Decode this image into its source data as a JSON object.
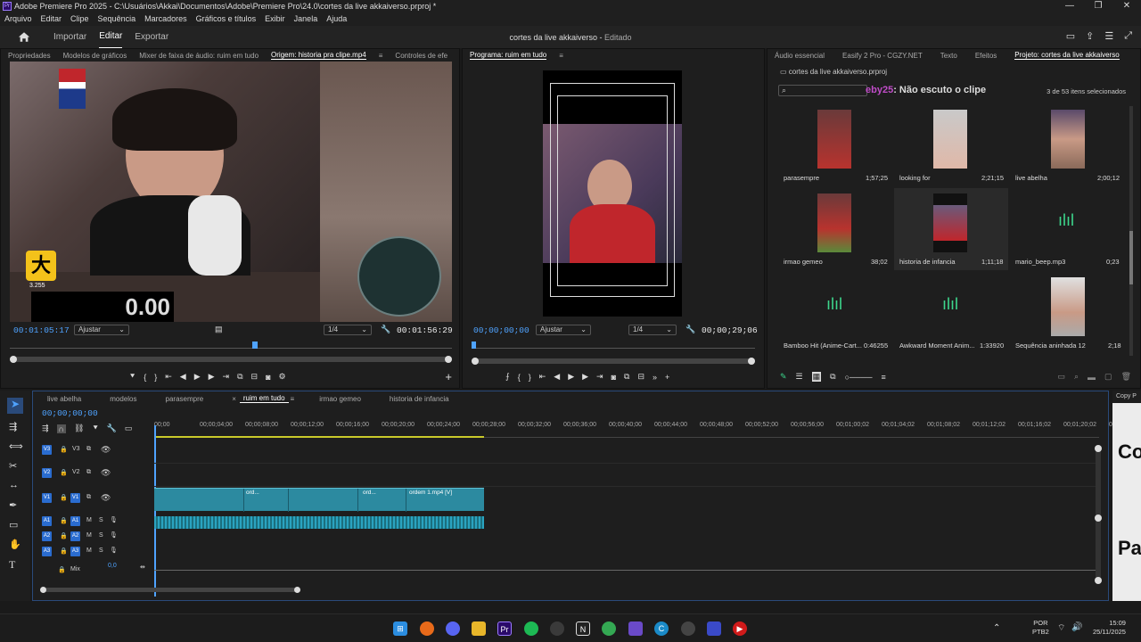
{
  "titlebar": {
    "title": "Adobe Premiere Pro 2025 - C:\\Usuários\\Akkai\\Documentos\\Adobe\\Premiere Pro\\24.0\\cortes da live akkaiverso.prproj *",
    "logo": "Pr",
    "min": "—",
    "max": "❐",
    "close": "✕"
  },
  "menu": [
    "Arquivo",
    "Editar",
    "Clipe",
    "Sequência",
    "Marcadores",
    "Gráficos e títulos",
    "Exibir",
    "Janela",
    "Ajuda"
  ],
  "header": {
    "home_icon": "home-icon",
    "tabs": [
      "Importar",
      "Editar",
      "Exportar"
    ],
    "active_tab": "Editar",
    "project_title": "cortes da live akkaiverso",
    "project_status": "Editado"
  },
  "source_panel": {
    "tabs": [
      "Propriedades",
      "Modelos de gráficos",
      "Mixer de faixa de áudio: ruim em tudo",
      "Origem: historia pra clipe.mp4",
      "Controles de efe"
    ],
    "active_tab": "Origem: historia pra clipe.mp4",
    "overlay_counter": "3.255",
    "overlay_timer": "0.00",
    "timecode_in": "00:01:05:17",
    "fit": "Ajustar",
    "resolution": "1/4",
    "timecode_out": "00:01:56:29"
  },
  "program_panel": {
    "title": "Programa: ruim em tudo",
    "timecode_in": "00;00;00;00",
    "fit": "Ajustar",
    "resolution": "1/4",
    "timecode_out": "00;00;29;06"
  },
  "project_panel": {
    "tabs": [
      "Áudio essencial",
      "Easify 2 Pro - CGZY.NET",
      "Texto",
      "Efeitos",
      "Projeto: cortes da live akkaiverso"
    ],
    "active_tab": "Projeto: cortes da live akkaiverso",
    "project_file": "cortes da live akkaiverso.prproj",
    "search_placeholder": "",
    "chat_user": "eby25",
    "chat_message": ": Não escuto o clipe",
    "selection_info": "3 de 53 itens selecionados",
    "items": [
      {
        "name": "parasempre",
        "duration": "1;57;25"
      },
      {
        "name": "looking for",
        "duration": "2;21;15"
      },
      {
        "name": "live abelha",
        "duration": "2;00;12"
      },
      {
        "name": "irmao gemeo",
        "duration": "38;02"
      },
      {
        "name": "historia de infancia",
        "duration": "1;11;18"
      },
      {
        "name": "mario_beep.mp3",
        "duration": "0;23"
      },
      {
        "name": "Bamboo Hit (Anime-Cart...",
        "duration": "0:46255"
      },
      {
        "name": "Awkward Moment Anim...",
        "duration": "1:33920"
      },
      {
        "name": "Sequência aninhada 12",
        "duration": "2;18"
      }
    ]
  },
  "timeline": {
    "tabs": [
      "live abelha",
      "modelos",
      "parasempre",
      "ruim em tudo",
      "irmao gemeo",
      "historia de infancia"
    ],
    "active_tab": "ruim em tudo",
    "close_mark": "×",
    "timecode": "00;00;00;00",
    "ruler": [
      "00;00",
      "00;00;04;00",
      "00;00;08;00",
      "00;00;12;00",
      "00;00;16;00",
      "00;00;20;00",
      "00;00;24;00",
      "00;00;28;00",
      "00;00;32;00",
      "00;00;36;00",
      "00;00;40;00",
      "00;00;44;00",
      "00;00;48;00",
      "00;00;52;00",
      "00;00;56;00",
      "00;01;00;02",
      "00;01;04;02",
      "00;01;08;02",
      "00;01;12;02",
      "00;01;16;02",
      "00;01;20;02",
      "00;"
    ],
    "tracks_video": [
      "V3",
      "V2",
      "V1"
    ],
    "tracks_audio": [
      "A1",
      "A2",
      "A3"
    ],
    "mix_label": "Mix",
    "mix_value": "0,0",
    "clip_labels": [
      "ord...",
      "ord...",
      "ordem 1.mp4 [V]"
    ],
    "audio_m": "M",
    "audio_s": "S"
  },
  "right_edge": {
    "label_top": "Copy P",
    "big1": "Co",
    "big2": "Pa"
  },
  "taskbar": {
    "lang": "POR",
    "layout": "PTB2",
    "time": "15:09",
    "date": "25/11/2025"
  },
  "colors": {
    "accent_blue": "#2a6ccf",
    "timecode_blue": "#4fa3ff",
    "clip_teal": "#2c8aa0",
    "audio_teal": "#1b6f7e"
  }
}
